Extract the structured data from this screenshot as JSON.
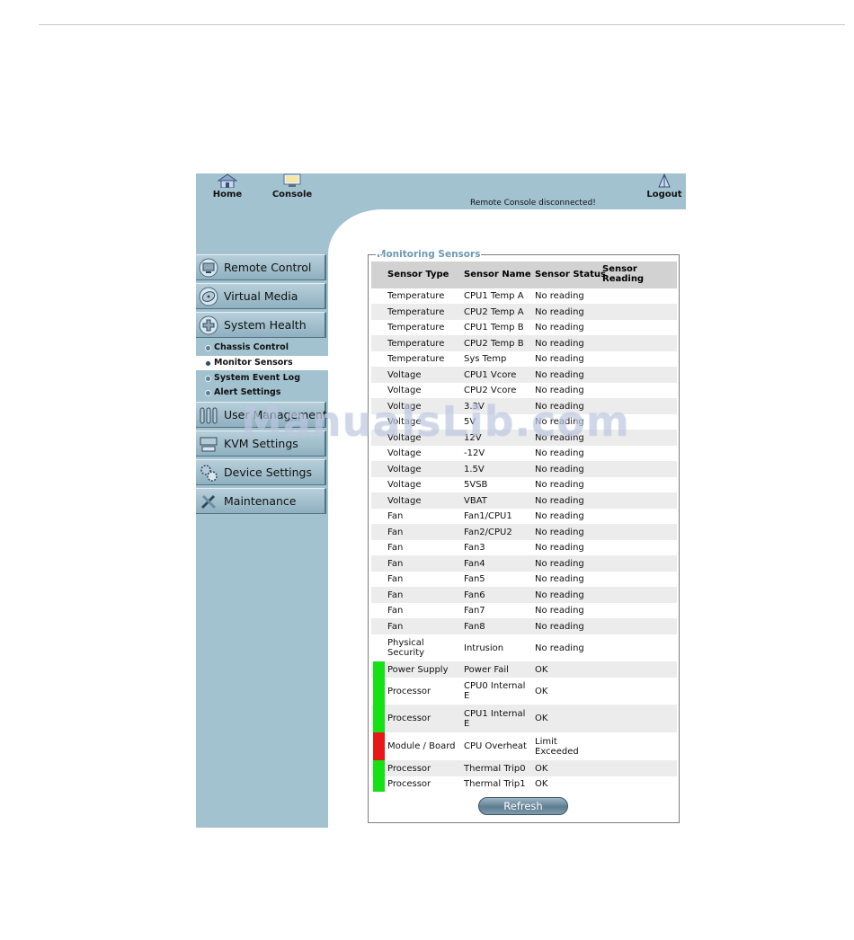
{
  "toolbar": {
    "home_label": "Home",
    "console_label": "Console",
    "logout_label": "Logout",
    "status_message": "Remote Console disconnected!"
  },
  "sidebar": {
    "items": [
      {
        "label": "Remote Control",
        "icon": "monitor-icon"
      },
      {
        "label": "Virtual Media",
        "icon": "disc-icon"
      },
      {
        "label": "System Health",
        "icon": "health-cross-icon"
      },
      {
        "label": "User Management",
        "icon": "users-icon"
      },
      {
        "label": "KVM Settings",
        "icon": "keyboard-icon"
      },
      {
        "label": "Device Settings",
        "icon": "gears-icon"
      },
      {
        "label": "Maintenance",
        "icon": "tools-icon"
      }
    ],
    "subitems": [
      {
        "label": "Chassis Control",
        "active": false
      },
      {
        "label": "Monitor Sensors",
        "active": true
      },
      {
        "label": "System Event Log",
        "active": false
      },
      {
        "label": "Alert Settings",
        "active": false
      }
    ]
  },
  "panel": {
    "legend": "Monitoring Sensors",
    "columns": [
      "Sensor Type",
      "Sensor Name",
      "Sensor Status",
      "Sensor Reading"
    ],
    "rows": [
      {
        "type": "Temperature",
        "name": "CPU1 Temp A",
        "status": "No reading",
        "reading": "",
        "indicator": ""
      },
      {
        "type": "Temperature",
        "name": "CPU2 Temp A",
        "status": "No reading",
        "reading": "",
        "indicator": ""
      },
      {
        "type": "Temperature",
        "name": "CPU1 Temp B",
        "status": "No reading",
        "reading": "",
        "indicator": ""
      },
      {
        "type": "Temperature",
        "name": "CPU2 Temp B",
        "status": "No reading",
        "reading": "",
        "indicator": ""
      },
      {
        "type": "Temperature",
        "name": "Sys Temp",
        "status": "No reading",
        "reading": "",
        "indicator": ""
      },
      {
        "type": "Voltage",
        "name": "CPU1 Vcore",
        "status": "No reading",
        "reading": "",
        "indicator": ""
      },
      {
        "type": "Voltage",
        "name": "CPU2 Vcore",
        "status": "No reading",
        "reading": "",
        "indicator": ""
      },
      {
        "type": "Voltage",
        "name": "3.3V",
        "status": "No reading",
        "reading": "",
        "indicator": ""
      },
      {
        "type": "Voltage",
        "name": "5V",
        "status": "No reading",
        "reading": "",
        "indicator": ""
      },
      {
        "type": "Voltage",
        "name": "12V",
        "status": "No reading",
        "reading": "",
        "indicator": ""
      },
      {
        "type": "Voltage",
        "name": "-12V",
        "status": "No reading",
        "reading": "",
        "indicator": ""
      },
      {
        "type": "Voltage",
        "name": "1.5V",
        "status": "No reading",
        "reading": "",
        "indicator": ""
      },
      {
        "type": "Voltage",
        "name": "5VSB",
        "status": "No reading",
        "reading": "",
        "indicator": ""
      },
      {
        "type": "Voltage",
        "name": "VBAT",
        "status": "No reading",
        "reading": "",
        "indicator": ""
      },
      {
        "type": "Fan",
        "name": "Fan1/CPU1",
        "status": "No reading",
        "reading": "",
        "indicator": ""
      },
      {
        "type": "Fan",
        "name": "Fan2/CPU2",
        "status": "No reading",
        "reading": "",
        "indicator": ""
      },
      {
        "type": "Fan",
        "name": "Fan3",
        "status": "No reading",
        "reading": "",
        "indicator": ""
      },
      {
        "type": "Fan",
        "name": "Fan4",
        "status": "No reading",
        "reading": "",
        "indicator": ""
      },
      {
        "type": "Fan",
        "name": "Fan5",
        "status": "No reading",
        "reading": "",
        "indicator": ""
      },
      {
        "type": "Fan",
        "name": "Fan6",
        "status": "No reading",
        "reading": "",
        "indicator": ""
      },
      {
        "type": "Fan",
        "name": "Fan7",
        "status": "No reading",
        "reading": "",
        "indicator": ""
      },
      {
        "type": "Fan",
        "name": "Fan8",
        "status": "No reading",
        "reading": "",
        "indicator": ""
      },
      {
        "type": "Physical Security",
        "name": "Intrusion",
        "status": "No reading",
        "reading": "",
        "indicator": ""
      },
      {
        "type": "Power Supply",
        "name": "Power Fail",
        "status": "OK",
        "reading": "",
        "indicator": "#16e016"
      },
      {
        "type": "Processor",
        "name": "CPU0 Internal E",
        "status": "OK",
        "reading": "",
        "indicator": "#16e016"
      },
      {
        "type": "Processor",
        "name": "CPU1 Internal E",
        "status": "OK",
        "reading": "",
        "indicator": "#16e016"
      },
      {
        "type": "Module / Board",
        "name": "CPU Overheat",
        "status": "Limit Exceeded",
        "reading": "",
        "indicator": "#e81818"
      },
      {
        "type": "Processor",
        "name": "Thermal Trip0",
        "status": "OK",
        "reading": "",
        "indicator": "#16e016"
      },
      {
        "type": "Processor",
        "name": "Thermal Trip1",
        "status": "OK",
        "reading": "",
        "indicator": "#16e016"
      }
    ],
    "refresh_label": "Refresh"
  },
  "watermark": "ManualsLib.com"
}
